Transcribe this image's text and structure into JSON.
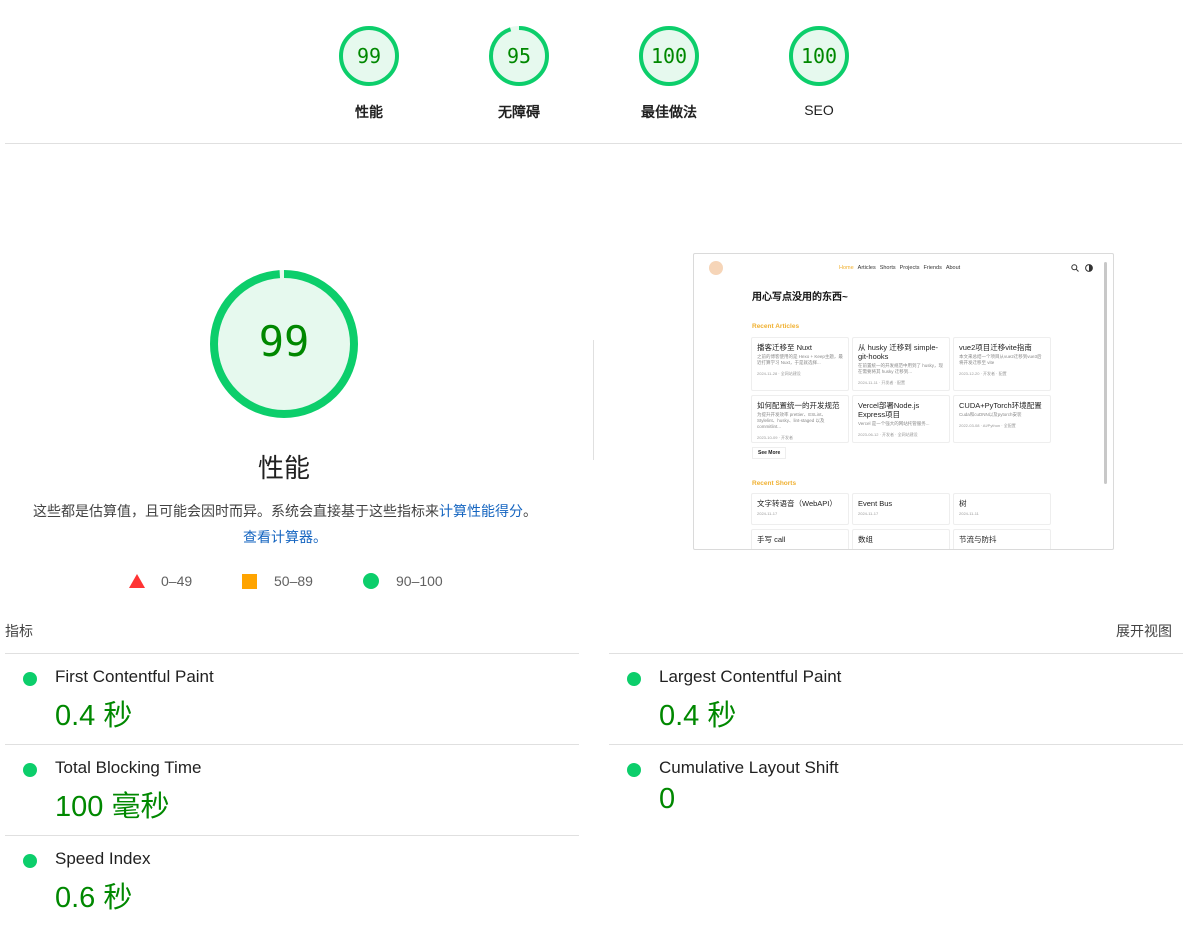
{
  "colors": {
    "pass": "#0cce6b",
    "pass_text": "#008800",
    "average": "#ffa400",
    "fail": "#ff3333",
    "link": "#1565c0"
  },
  "summary": [
    {
      "score": "99",
      "label": "性能"
    },
    {
      "score": "95",
      "label": "无障碍"
    },
    {
      "score": "100",
      "label": "最佳做法"
    },
    {
      "score": "100",
      "label": "SEO"
    }
  ],
  "performance": {
    "score": "99",
    "title": "性能",
    "desc_text": "这些都是估算值，且可能会因时而异。系统会直接基于这些指标来",
    "desc_link1": "计算性能得分",
    "desc_sep": "。",
    "desc_link2": "查看计算器。"
  },
  "legend": [
    {
      "shape": "triangle",
      "range": "0–49"
    },
    {
      "shape": "square",
      "range": "50–89"
    },
    {
      "shape": "circle",
      "range": "90–100"
    }
  ],
  "thumbnail": {
    "nav": [
      "Home",
      "Articles",
      "Shorts",
      "Projects",
      "Friends",
      "About"
    ],
    "headline": "用心写点没用的东西~",
    "recent_articles_label": "Recent Articles",
    "articles": [
      {
        "title": "播客迁移至 Nuxt",
        "desc": "之前的博客使用的是 Hexo + Keep主题，最近打算学习 Nuxt，于是就选择...",
        "meta": "2024-11-28 · 全网站建设"
      },
      {
        "title": "从 husky 迁移到 simple-git-hooks",
        "desc": "在前置统一的开发规范中用到了 husky，现在需要将其 husky 迁移到...",
        "meta": "2024-11-11 · 开发者 · 配置"
      },
      {
        "title": "vue2项目迁移vite指南",
        "desc": "本文来总结一个项目从vue2迁移到vue3后将开发迁移至 vite",
        "meta": "2023-12-20 · 开发者 · 配置"
      },
      {
        "title": "如何配置统一的开发规范",
        "desc": "为提升开发效率 prettier、ESLint、Stylelint、husky、lint-staged 以及 commitlint...",
        "meta": "2023-10-09 · 开发者"
      },
      {
        "title": "Vercel部署Node.js Express项目",
        "desc": "Vercel 是一个强大的网站托管服务...",
        "meta": "2023-06-12 · 开发者 · 全网站建设"
      },
      {
        "title": "CUDA+PyTorch环境配置",
        "desc": "Cuda和cuDNN以及pytorch安装",
        "meta": "2022-03-08 · AI/Python · 全配置"
      }
    ],
    "see_more": "See More",
    "recent_shorts_label": "Recent Shorts",
    "shorts": [
      {
        "title": "文字转语音（WebAPI）",
        "meta": "2024-11-17"
      },
      {
        "title": "Event Bus",
        "meta": "2024-11-17"
      },
      {
        "title": "树",
        "meta": "2024-11-11"
      },
      {
        "title": "手写 call",
        "meta": ""
      },
      {
        "title": "数组",
        "meta": ""
      },
      {
        "title": "节流与防抖",
        "meta": ""
      }
    ]
  },
  "metrics": {
    "heading": "指标",
    "expand_label": "展开视图",
    "items": [
      {
        "name": "First Contentful Paint",
        "value": "0.4 秒"
      },
      {
        "name": "Largest Contentful Paint",
        "value": "0.4 秒"
      },
      {
        "name": "Total Blocking Time",
        "value": "100 毫秒"
      },
      {
        "name": "Cumulative Layout Shift",
        "value": "0"
      },
      {
        "name": "Speed Index",
        "value": "0.6 秒"
      }
    ]
  }
}
